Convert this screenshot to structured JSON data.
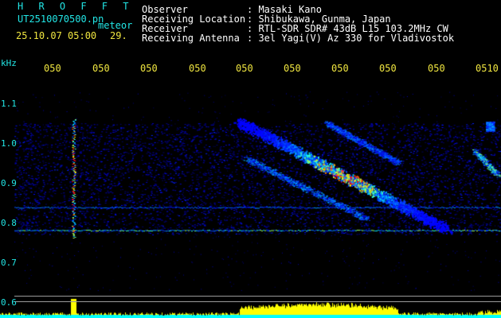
{
  "header": {
    "brand": "H R O F F T",
    "file_id": "UT2510070500.pn",
    "file_tag": "meteor",
    "datetime": "25.10.07 05:00",
    "count": "29."
  },
  "meta": [
    {
      "label": "Observer",
      "value": ": Masaki Kano"
    },
    {
      "label": "Receiving Location",
      "value": ": Shibukawa, Gunma, Japan"
    },
    {
      "label": "Receiver",
      "value": ": RTL-SDR SDR# 43dB L15 103.2MHz CW"
    },
    {
      "label": "Receiving Antenna",
      "value": ": 3el Yagi(V) Az 330 for Vladivostok"
    }
  ],
  "time_axis": {
    "ticks": [
      "050",
      "050",
      "050",
      "050",
      "050",
      "050",
      "050",
      "050",
      "050",
      "0510"
    ]
  },
  "freq_axis": {
    "unit": "kHz",
    "ticks": [
      "1.1",
      "1.0",
      "0.9",
      "0.8",
      "0.7",
      "0.6"
    ]
  },
  "colors": {
    "label": "#22e6e6",
    "value": "#ffffff",
    "tick": "#f0e640",
    "background": "#000000"
  }
}
